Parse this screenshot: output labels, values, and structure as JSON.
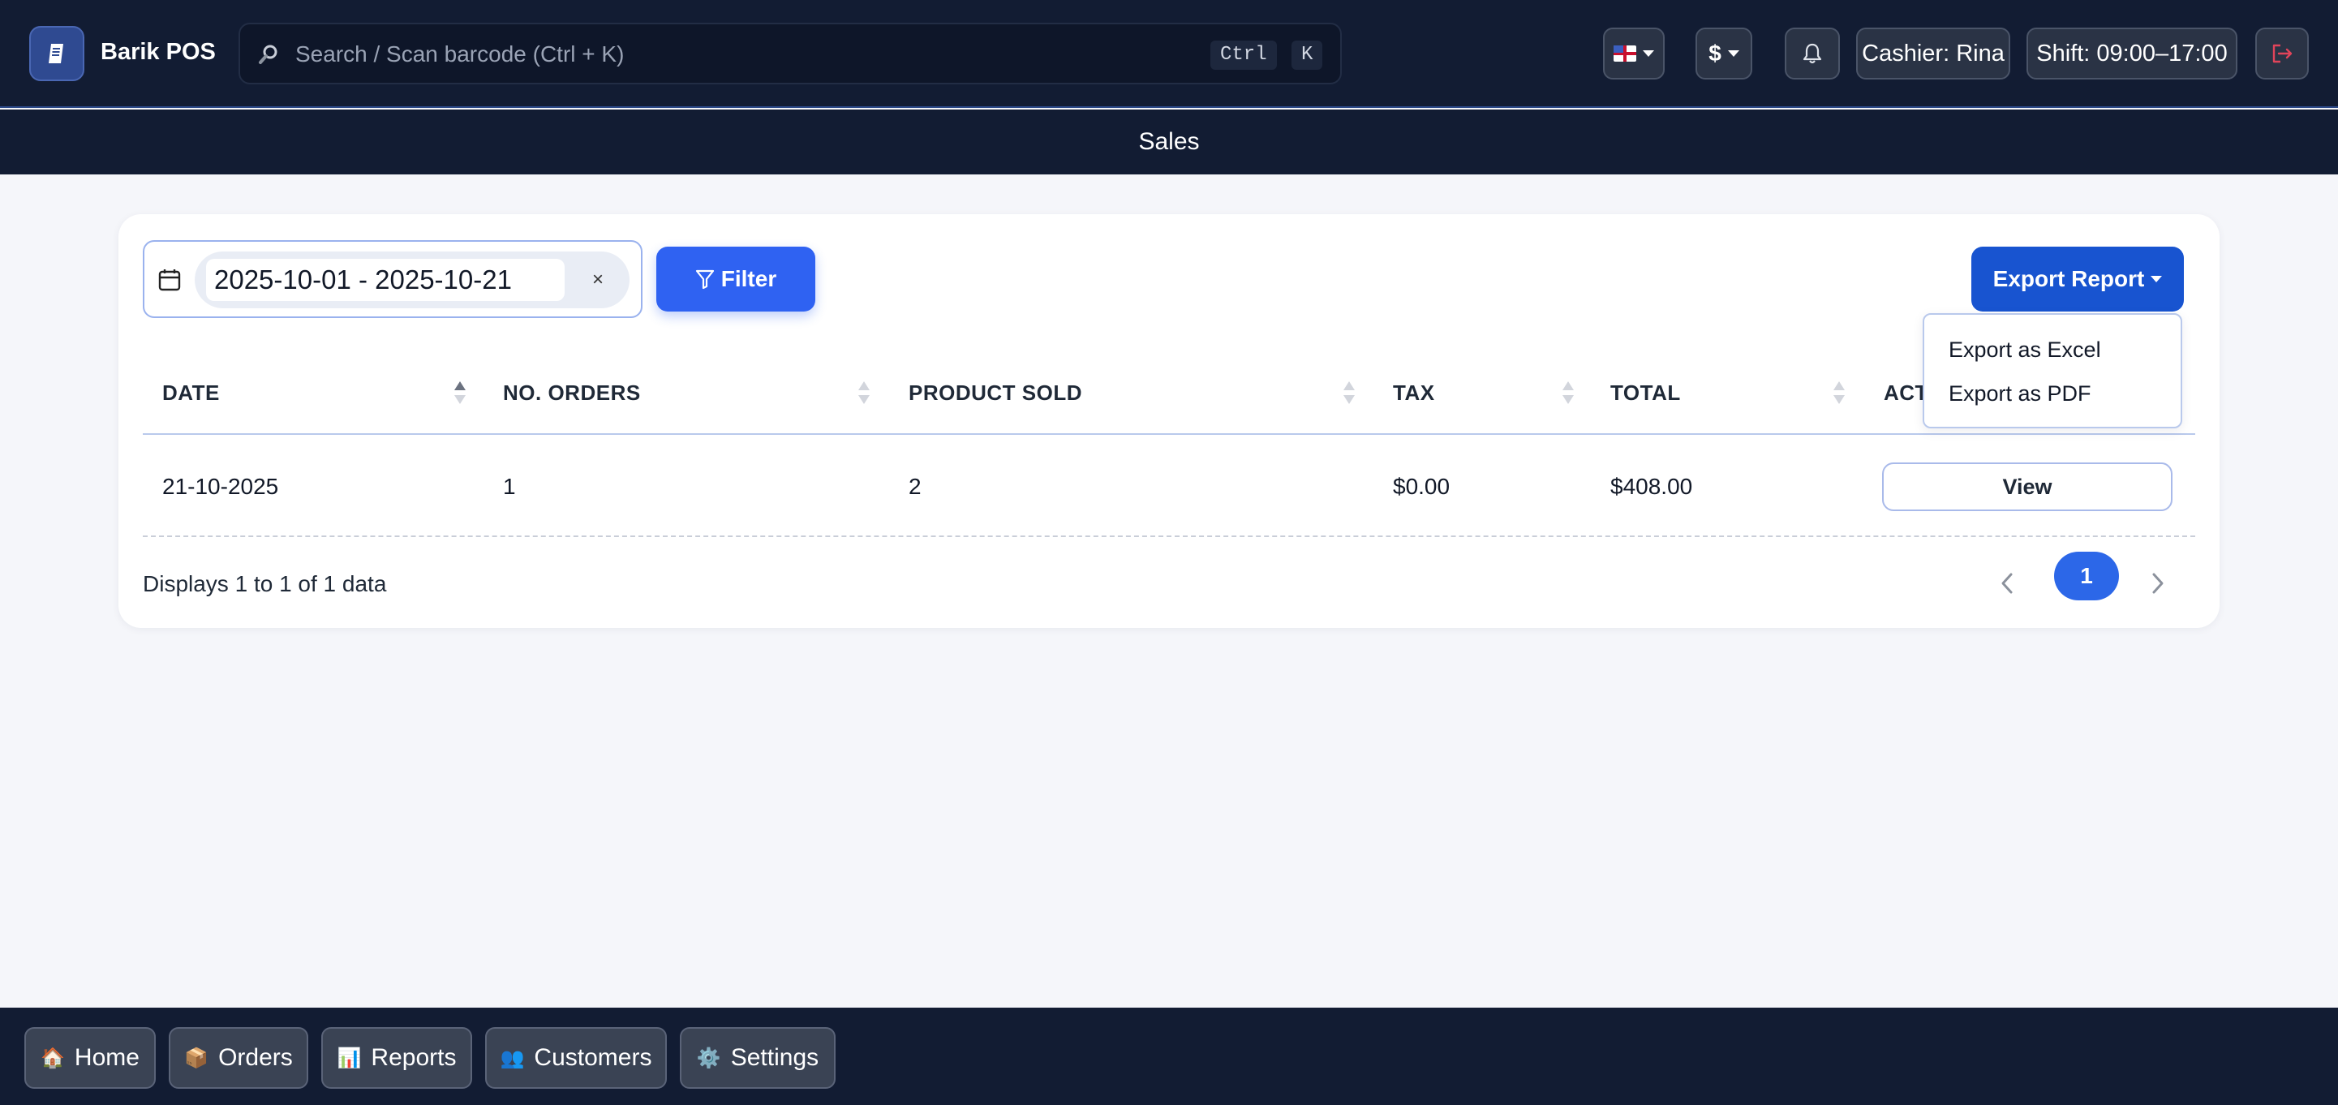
{
  "app": {
    "name": "Barik POS"
  },
  "header": {
    "search_placeholder": "Search / Scan barcode (Ctrl + K)",
    "shortcut_ctrl": "Ctrl",
    "shortcut_k": "K",
    "currency_symbol": "$",
    "cashier": "Cashier: Rina",
    "shift": "Shift: 09:00–17:00"
  },
  "page": {
    "title": "Sales"
  },
  "filters": {
    "date_range": "2025-10-01 - 2025-10-21",
    "clear_label": "×",
    "filter_label": "Filter",
    "export_label": "Export Report"
  },
  "export_menu": {
    "items": [
      {
        "label": "Export as Excel"
      },
      {
        "label": "Export as PDF"
      }
    ]
  },
  "table": {
    "columns": [
      {
        "label": "DATE"
      },
      {
        "label": "NO. ORDERS"
      },
      {
        "label": "PRODUCT SOLD"
      },
      {
        "label": "TAX"
      },
      {
        "label": "TOTAL"
      },
      {
        "label": "ACT"
      }
    ],
    "rows": [
      {
        "date": "21-10-2025",
        "orders": "1",
        "products_sold": "2",
        "tax": "$0.00",
        "total": "$408.00",
        "action": "View"
      }
    ]
  },
  "pagination": {
    "info": "Displays 1 to 1 of 1 data",
    "current_page": "1"
  },
  "bottom_nav": {
    "items": [
      {
        "icon": "🏠",
        "label": "Home"
      },
      {
        "icon": "📦",
        "label": "Orders"
      },
      {
        "icon": "📊",
        "label": "Reports"
      },
      {
        "icon": "👥",
        "label": "Customers"
      },
      {
        "icon": "⚙️",
        "label": "Settings"
      }
    ]
  },
  "colors": {
    "header_bg": "#121c33",
    "primary": "#2f62f2",
    "export_btn": "#1854d0",
    "page_bg": "#f5f6fa",
    "logout_icon": "#e0445a"
  }
}
